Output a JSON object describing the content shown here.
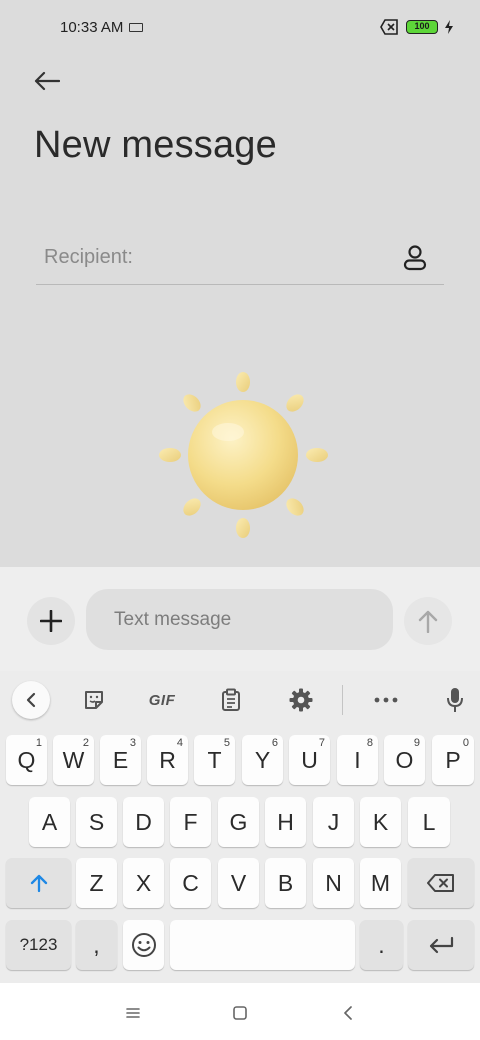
{
  "status_bar": {
    "time": "10:33 AM",
    "battery_level": "100",
    "icons": [
      "keyboard-icon",
      "sim-off-icon",
      "battery-icon",
      "charging-icon"
    ]
  },
  "header": {
    "title": "New message",
    "back_icon": "arrow-left-icon"
  },
  "recipient": {
    "label": "Recipient:",
    "contact_icon": "person-icon"
  },
  "compose": {
    "add_icon": "plus-icon",
    "placeholder": "Text message",
    "value": "",
    "send_icon": "arrow-up-icon"
  },
  "keyboard": {
    "toolbar": {
      "collapse_icon": "chevron-left-icon",
      "sticker_icon": "sticker-icon",
      "gif_label": "GIF",
      "clipboard_icon": "clipboard-icon",
      "settings_icon": "gear-icon",
      "more_icon": "more-horizontal-icon",
      "mic_icon": "microphone-icon"
    },
    "row1": [
      {
        "key": "Q",
        "hint": "1"
      },
      {
        "key": "W",
        "hint": "2"
      },
      {
        "key": "E",
        "hint": "3"
      },
      {
        "key": "R",
        "hint": "4"
      },
      {
        "key": "T",
        "hint": "5"
      },
      {
        "key": "Y",
        "hint": "6"
      },
      {
        "key": "U",
        "hint": "7"
      },
      {
        "key": "I",
        "hint": "8"
      },
      {
        "key": "O",
        "hint": "9"
      },
      {
        "key": "P",
        "hint": "0"
      }
    ],
    "row2": [
      "A",
      "S",
      "D",
      "F",
      "G",
      "H",
      "J",
      "K",
      "L"
    ],
    "row3": [
      "Z",
      "X",
      "C",
      "V",
      "B",
      "N",
      "M"
    ],
    "symbols_label": "?123",
    "comma": ",",
    "period": ".",
    "shift_icon": "shift-arrow-icon",
    "backspace_icon": "backspace-icon",
    "emoji_icon": "emoji-icon",
    "enter_icon": "enter-icon"
  },
  "nav_bar": {
    "icons": [
      "menu-icon",
      "home-square-icon",
      "back-chevron-icon"
    ]
  },
  "colors": {
    "accent": "#1e88e5",
    "background": "#dcdcdc",
    "battery": "#5dd639",
    "sun": "#f4dc8a"
  }
}
